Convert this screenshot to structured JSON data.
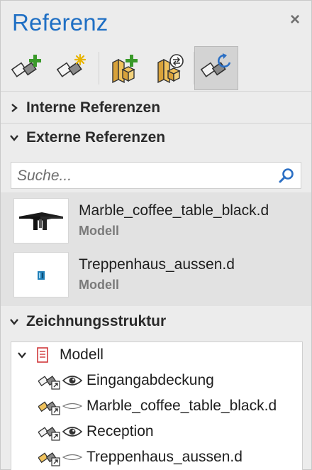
{
  "panel": {
    "title": "Referenz",
    "close_glyph": "×"
  },
  "toolbar": {
    "buttons": [
      {
        "icon": "add-reference-icon",
        "active": false
      },
      {
        "icon": "new-reference-icon",
        "active": false
      },
      {
        "icon": "add-block-icon",
        "active": false
      },
      {
        "icon": "swap-block-icon",
        "active": false
      },
      {
        "icon": "reload-reference-icon",
        "active": true
      }
    ]
  },
  "sections": {
    "internal": {
      "label": "Interne Referenzen",
      "expanded": false
    },
    "external": {
      "label": "Externe Referenzen",
      "expanded": true
    },
    "structure": {
      "label": "Zeichnungsstruktur",
      "expanded": true
    }
  },
  "search": {
    "placeholder": "Suche...",
    "value": ""
  },
  "external_refs": [
    {
      "name": "Marble_coffee_table_black.d",
      "type": "Modell",
      "thumb": "coffee-table-thumbnail"
    },
    {
      "name": "Treppenhaus_aussen.d",
      "type": "Modell",
      "thumb": "stairwell-thumbnail"
    }
  ],
  "tree": {
    "root": {
      "label": "Modell",
      "expanded": true
    },
    "children": [
      {
        "label": "Eingangabdeckung",
        "visible": true,
        "kind": "internal"
      },
      {
        "label": "Marble_coffee_table_black.d",
        "visible": false,
        "kind": "external"
      },
      {
        "label": "Reception",
        "visible": true,
        "kind": "internal"
      },
      {
        "label": "Treppenhaus_aussen.d",
        "visible": false,
        "kind": "external"
      }
    ]
  },
  "colors": {
    "title_blue": "#1f6fc4",
    "add_green": "#3a9a2a",
    "star_yellow": "#e8b400",
    "reload_blue": "#2b6fc4"
  }
}
